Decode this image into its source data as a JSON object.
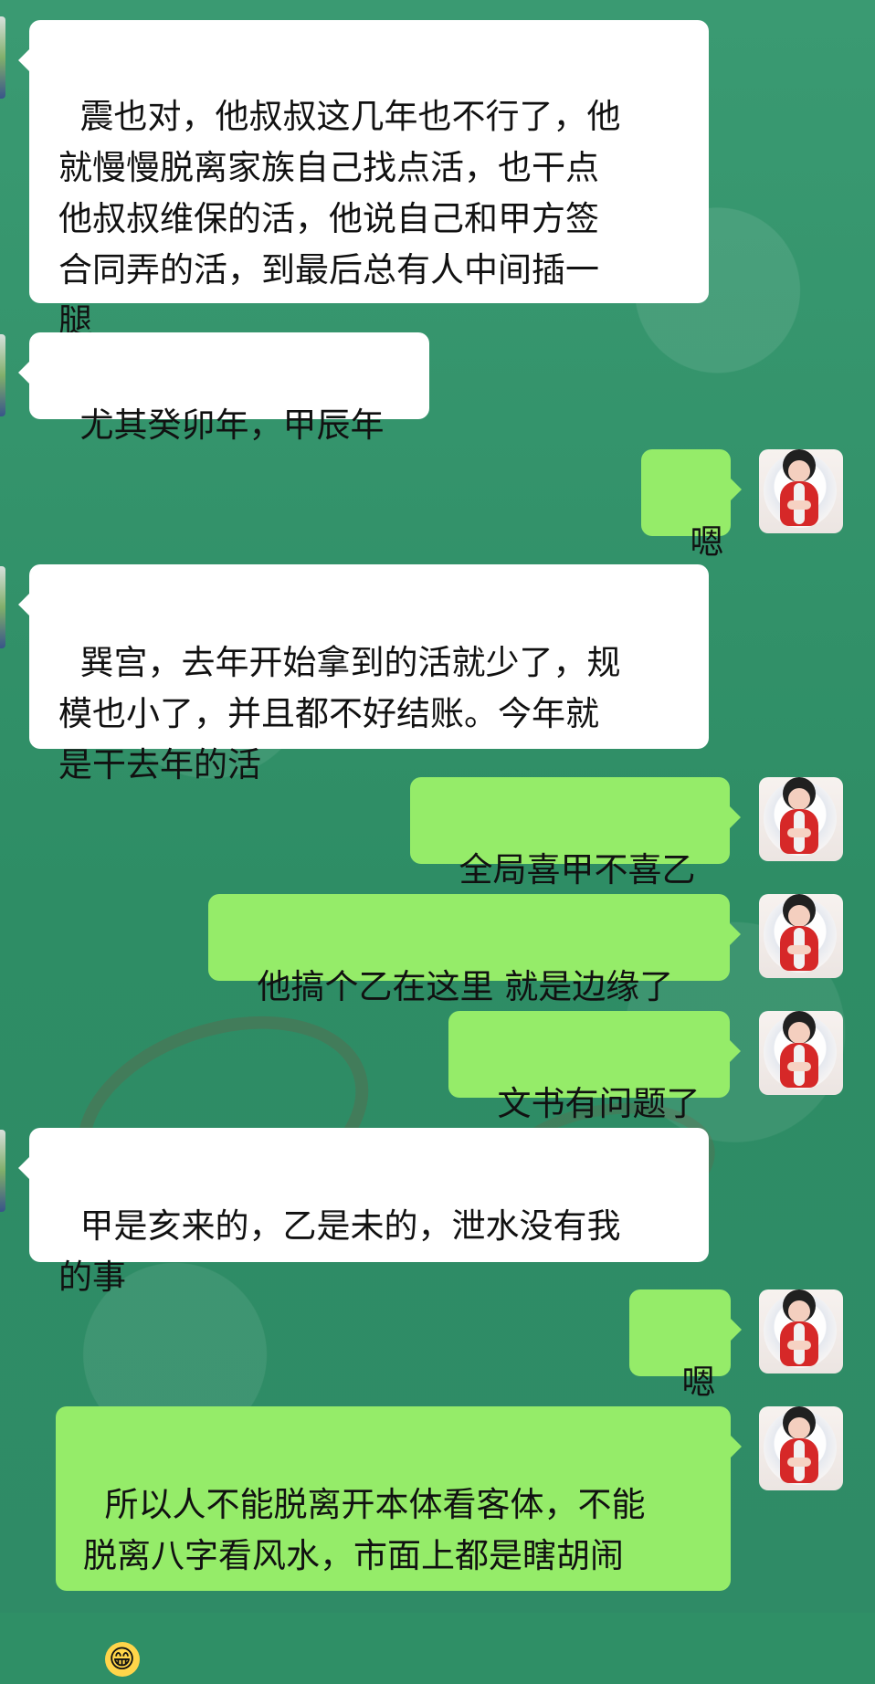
{
  "messages": [
    {
      "text": "震也对，他叔叔这几年也不行了，他\n就慢慢脱离家族自己找点活，也干点\n他叔叔维保的活，他说自己和甲方签\n合同弄的活，到最后总有人中间插一\n腿"
    },
    {
      "text": "尤其癸卯年，甲辰年"
    },
    {
      "text": "嗯"
    },
    {
      "text": "巽宫，去年开始拿到的活就少了，规\n模也小了，并且都不好结账。今年就\n是干去年的活"
    },
    {
      "text": "全局喜甲不喜乙"
    },
    {
      "text": "他搞个乙在这里 就是边缘了"
    },
    {
      "text": "文书有问题了"
    },
    {
      "text": "甲是亥来的，乙是未的，泄水没有我\n的事"
    },
    {
      "text": "嗯"
    },
    {
      "text": "所以人不能脱离开本体看客体，不能\n脱离八字看风水，市面上都是瞎胡闹"
    }
  ],
  "emoji": {
    "symbol": "😁",
    "name": "grinning-face-emoji"
  },
  "icons": {
    "right_avatar": "user-avatar-icon",
    "left_avatar": "contact-avatar-icon"
  },
  "colors": {
    "background": "#2f8f66",
    "incoming": "#ffffff",
    "outgoing": "#95ec69"
  }
}
